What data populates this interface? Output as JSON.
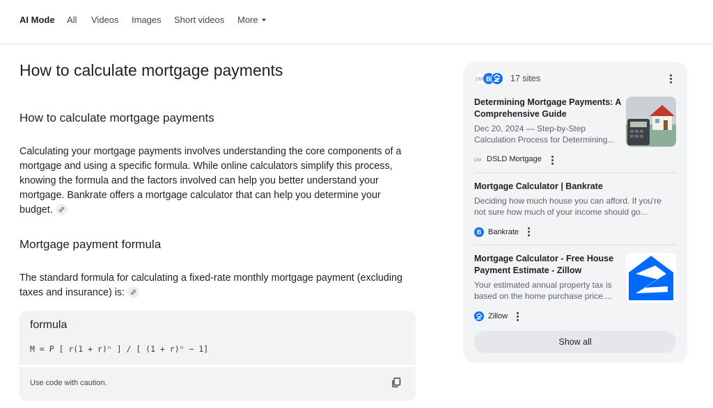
{
  "nav": {
    "tabs": [
      {
        "label": "AI Mode",
        "active": true
      },
      {
        "label": "All"
      },
      {
        "label": "Videos"
      },
      {
        "label": "Images"
      },
      {
        "label": "Short videos"
      },
      {
        "label": "More",
        "icon": "caret-down-icon"
      }
    ]
  },
  "main": {
    "title": "How to calculate mortgage payments",
    "section1": {
      "heading": "How to calculate mortgage payments",
      "lines": [
        "Calculating your mortgage payments involves understanding the core components of a",
        "mortgage and using a specific formula. While online calculators simplify this process,",
        "knowing the formula and the factors involved can help you better understand your",
        "mortgage. Bankrate offers a mortgage calculator that can help you determine your",
        "budget."
      ]
    },
    "section2": {
      "heading": "Mortgage payment formula",
      "lines": [
        "The standard formula for calculating a fixed-rate monthly mortgage payment (excluding",
        "taxes and insurance) is:"
      ]
    },
    "code": {
      "language": "formula",
      "text": "M = P [ r(1 + r)ⁿ ] / [ (1 + r)ⁿ − 1]",
      "caution": "Use code with caution."
    }
  },
  "sources": {
    "count_label": "17 sites",
    "items": [
      {
        "title_lines": [
          "Determining Mortgage Payments: A",
          "Comprehensive Guide"
        ],
        "snippet_lines": [
          "Dec 20, 2024 — Step-by-Step",
          "Calculation Process for Determining..."
        ],
        "site": "DSLD Mortgage"
      },
      {
        "title_lines": [
          "Mortgage Calculator | Bankrate"
        ],
        "snippet_lines": [
          "Deciding how much house you can afford. If you're",
          "not sure how much of your income should go..."
        ],
        "site": "Bankrate"
      },
      {
        "title_lines": [
          "Mortgage Calculator - Free House",
          "Payment Estimate - Zillow"
        ],
        "snippet_lines": [
          "Your estimated annual property tax is",
          "based on the home purchase price...."
        ],
        "site": "Zillow"
      }
    ],
    "show_all_label": "Show all"
  },
  "colors": {
    "bankrate_blue": "#1a73e8",
    "zillow_blue": "#006aff",
    "card_bg": "#f3f4f6",
    "code_bg": "#f1f3f4"
  }
}
